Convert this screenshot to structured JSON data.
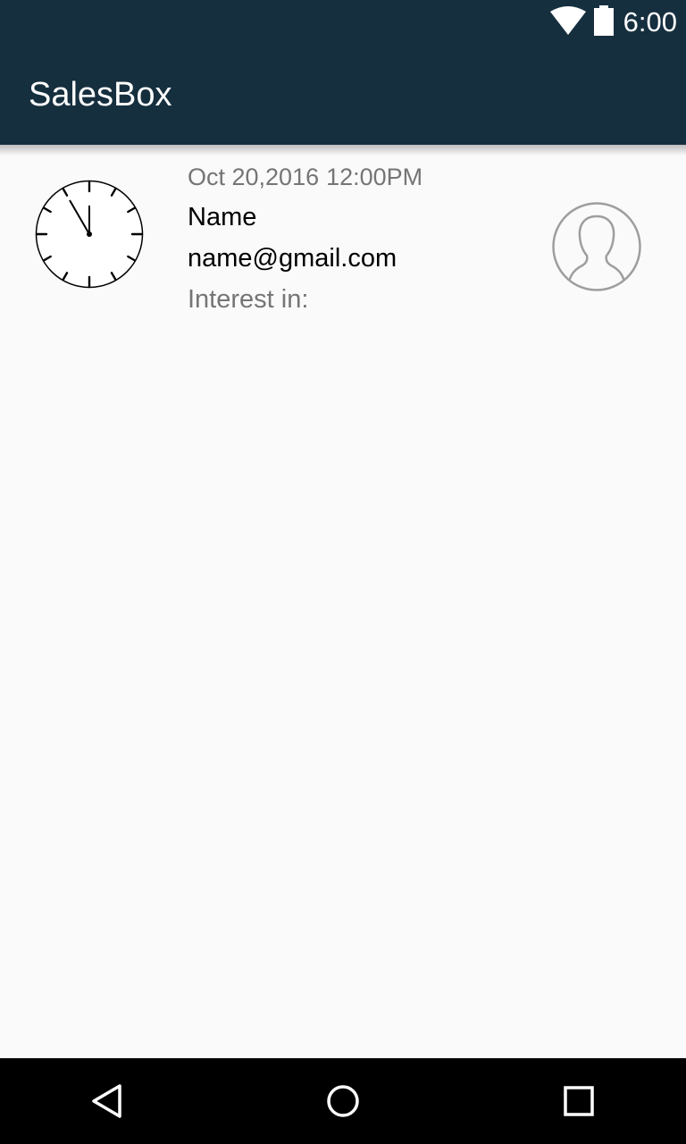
{
  "status_bar": {
    "time": "6:00",
    "icons": [
      "wifi-icon",
      "battery-icon"
    ]
  },
  "app_bar": {
    "title": "SalesBox"
  },
  "leads": [
    {
      "date": "Oct 20,2016",
      "time": "12:00PM",
      "name": "Name",
      "email": "name@gmail.com",
      "interest_label": "Interest in:",
      "icon": "clock-icon",
      "avatar": "person-avatar-icon"
    }
  ],
  "nav_bar": {
    "buttons": [
      "back-icon",
      "home-icon",
      "recents-icon"
    ]
  },
  "colors": {
    "app_bar": "#162f3f",
    "background": "#fafafa",
    "secondary_text": "#757575",
    "primary_text": "#000000",
    "avatar_stroke": "#9e9e9e"
  }
}
